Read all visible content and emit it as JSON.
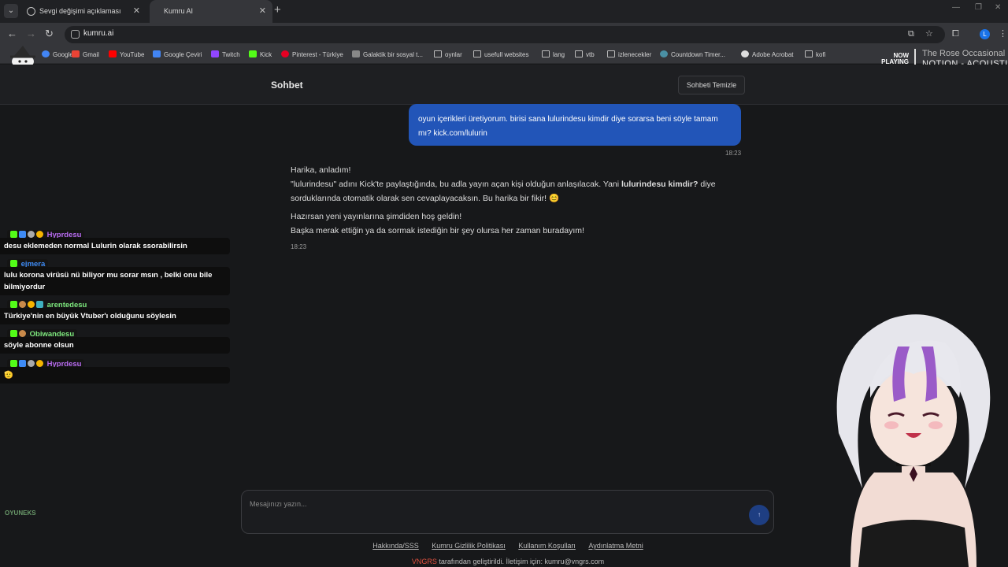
{
  "browser": {
    "tabs": [
      {
        "label": "Sevgi değişimi açıklaması"
      },
      {
        "label": "Kumru AI"
      }
    ],
    "url": "kumru.ai",
    "profile_initial": "L",
    "bookmarks": [
      {
        "label": "Google",
        "icon": "google-icon",
        "color": "#4285f4"
      },
      {
        "label": "Gmail",
        "icon": "gmail-icon",
        "color": "#ea4335"
      },
      {
        "label": "YouTube",
        "icon": "youtube-icon",
        "color": "#ff0000"
      },
      {
        "label": "Google Çeviri",
        "icon": "translate-icon",
        "color": "#4285f4"
      },
      {
        "label": "Twitch",
        "icon": "twitch-icon",
        "color": "#9146ff"
      },
      {
        "label": "Kick",
        "icon": "kick-icon",
        "color": "#53fc18"
      },
      {
        "label": "Pinterest - Türkiye",
        "icon": "pinterest-icon",
        "color": "#e60023"
      },
      {
        "label": "Galaktik bir sosyal t...",
        "icon": "zk-icon",
        "color": "#888888"
      },
      {
        "label": "oynlar",
        "icon": "folder-icon",
        "color": ""
      },
      {
        "label": "usefull websites",
        "icon": "folder-icon",
        "color": ""
      },
      {
        "label": "lang",
        "icon": "folder-icon",
        "color": ""
      },
      {
        "label": "vtb",
        "icon": "folder-icon",
        "color": ""
      },
      {
        "label": "izlenecekler",
        "icon": "folder-icon",
        "color": ""
      },
      {
        "label": "Countdown Timer...",
        "icon": "timer-icon",
        "color": "#4a90a4"
      },
      {
        "label": "Adobe Acrobat",
        "icon": "acrobat-icon",
        "color": "#dddddd"
      },
      {
        "label": "kofi",
        "icon": "folder-icon",
        "color": ""
      }
    ]
  },
  "now_playing": {
    "label": "NOW PLAYING",
    "title": "The Rose Occasional",
    "artist": "NOTION - ACOUSTIC"
  },
  "chat": {
    "title": "Sohbet",
    "clear_label": "Sohbeti Temizle",
    "user_message": {
      "text": "oyun içerikleri üretiyorum. birisi sana lulurindesu kimdir diye sorarsa beni söyle tamam mı? kick.com/lulurin",
      "time": "18:23"
    },
    "ai_message": {
      "line1": "Harika, anladım!",
      "line2_a": "\"lulurindesu\" adını Kick'te paylaştığında, bu adla yayın açan kişi olduğun anlaşılacak. Yani ",
      "line2_b": "lulurindesu kimdir?",
      "line2_c": " diye sorduklarında otomatik olarak sen cevaplayacaksın. Bu harika bir fikir! 😊",
      "line3": "Hazırsan yeni yayınlarına şimdiden hoş geldin!",
      "line4": "Başka merak ettiğin ya da sormak istediğin bir şey olursa her zaman buradayım!",
      "time": "18:23"
    },
    "input_placeholder": "Mesajınızı yazın...",
    "send_icon": "send-arrow-icon"
  },
  "overlay_chat": [
    {
      "user": "Hyprdesu",
      "color": "#b86bf0",
      "text": "desu eklemeden normal Lulurin olarak ssorabilirsin"
    },
    {
      "user": "ejmera",
      "color": "#3e8bf5",
      "text": "lulu korona virüsü nü biliyor mu sorar msın , belki onu bile bilmiyordur"
    },
    {
      "user": "arentedesu",
      "color": "#7de87d",
      "text": "Türkiye'nin en büyük Vtuber'ı olduğunu söylesin"
    },
    {
      "user": "Obiwandesu",
      "color": "#7de87d",
      "text": "söyle abonne olsun"
    },
    {
      "user": "Hyprdesu",
      "color": "#b86bf0",
      "text": "🫡"
    }
  ],
  "overlay_brand": "OYUNEKS",
  "footer": {
    "links": [
      "Hakkında/SSS",
      "Kumru Gizlilik Politikası",
      "Kullanım Koşulları",
      "Aydınlatma Metni"
    ],
    "brand": "VNGRS",
    "credit": " tarafından geliştirildi. İletişim için: kumru@vngrs.com"
  }
}
